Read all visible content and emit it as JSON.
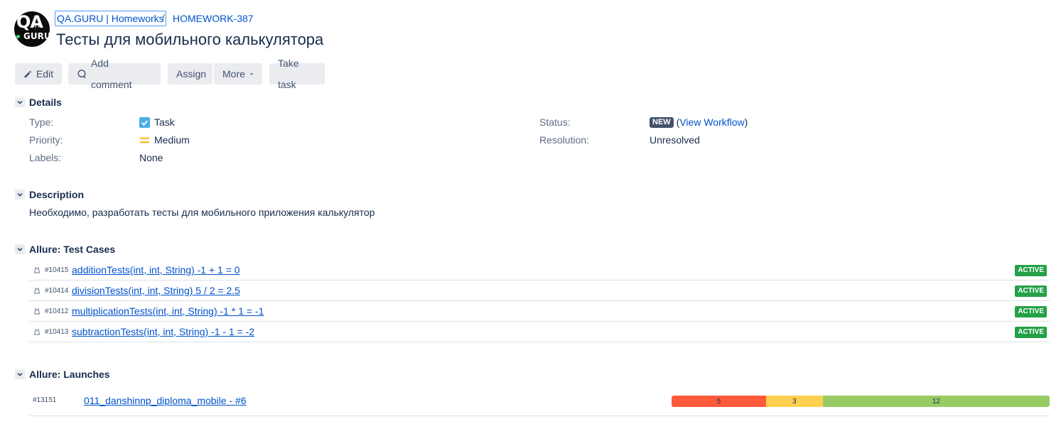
{
  "header": {
    "logo_text_top": "QA",
    "logo_text_bottom": "GURU",
    "breadcrumb_project": "QA.GURU | Homeworks",
    "breadcrumb_separator": "/",
    "breadcrumb_issue_key": "HOMEWORK-387",
    "title": "Тесты для мобильного калькулятора"
  },
  "toolbar": {
    "edit": "Edit",
    "add_comment": "Add comment",
    "assign": "Assign",
    "more": "More",
    "take_task": "Take task"
  },
  "details": {
    "heading": "Details",
    "type_label": "Type:",
    "type_value": "Task",
    "priority_label": "Priority:",
    "priority_value": "Medium",
    "labels_label": "Labels:",
    "labels_value": "None",
    "status_label": "Status:",
    "status_value": "NEW",
    "view_workflow": "View Workflow",
    "resolution_label": "Resolution:",
    "resolution_value": "Unresolved"
  },
  "description": {
    "heading": "Description",
    "text": "Необходимо, разработать тесты для мобильного приложения калькулятор"
  },
  "test_cases": {
    "heading": "Allure: Test Cases",
    "items": [
      {
        "id": "#10415",
        "name": "additionTests(int, int, String) -1 + 1 = 0",
        "status": "ACTIVE"
      },
      {
        "id": "#10414",
        "name": "divisionTests(int, int, String) 5 / 2 = 2.5",
        "status": "ACTIVE"
      },
      {
        "id": "#10412",
        "name": "multiplicationTests(int, int, String) -1 * 1 = -1",
        "status": "ACTIVE"
      },
      {
        "id": "#10413",
        "name": "subtractionTests(int, int, String) -1 - 1 = -2",
        "status": "ACTIVE"
      }
    ]
  },
  "launches": {
    "heading": "Allure: Launches",
    "items": [
      {
        "id": "#13151",
        "name": "011_danshinnp_diploma_mobile - #6",
        "failed": "5",
        "broken": "3",
        "passed": "12"
      }
    ]
  },
  "colors": {
    "link": "#0052cc",
    "failed": "#ff5b3b",
    "broken": "#ffd050",
    "passed": "#97cc64",
    "active_badge": "#24a148"
  }
}
